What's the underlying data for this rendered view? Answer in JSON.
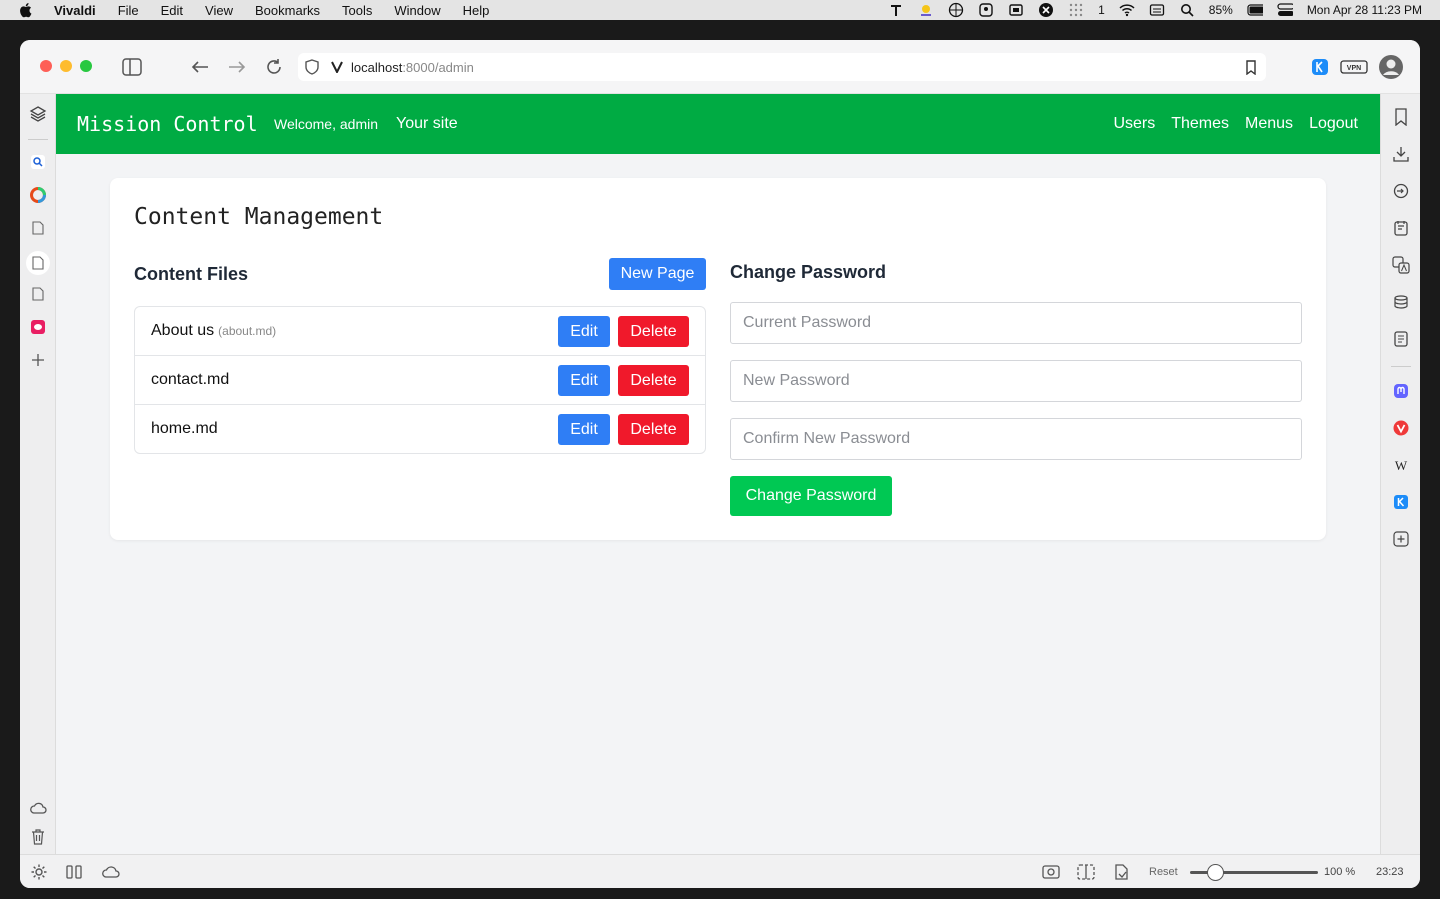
{
  "menubar": {
    "app": "Vivaldi",
    "items": [
      "File",
      "Edit",
      "View",
      "Bookmarks",
      "Tools",
      "Window",
      "Help"
    ],
    "tray_number": "1",
    "battery": "85%",
    "datetime": "Mon Apr 28  11:23 PM"
  },
  "browser": {
    "url_host": "localhost",
    "url_rest": ":8000/admin",
    "vpn_label": "VPN",
    "status": {
      "reset_label": "Reset",
      "zoom": "100 %",
      "zoom_fraction": 0.2,
      "clock": "23:23"
    }
  },
  "site": {
    "brand": "Mission Control",
    "welcome": "Welcome, admin",
    "your_site": "Your site",
    "nav": [
      "Users",
      "Themes",
      "Menus",
      "Logout"
    ]
  },
  "admin": {
    "title": "Content Management",
    "files_heading": "Content Files",
    "new_page_label": "New Page",
    "files": [
      {
        "name": "About us",
        "sub": "(about.md)"
      },
      {
        "name": "contact.md",
        "sub": ""
      },
      {
        "name": "home.md",
        "sub": ""
      }
    ],
    "edit_label": "Edit",
    "delete_label": "Delete",
    "password": {
      "heading": "Change Password",
      "current_placeholder": "Current Password",
      "new_placeholder": "New Password",
      "confirm_placeholder": "Confirm New Password",
      "button_label": "Change Password"
    }
  },
  "colors": {
    "nav_green": "#00ab43",
    "button_blue": "#2f7ef5",
    "button_red": "#f0192b",
    "button_green": "#00c853"
  }
}
